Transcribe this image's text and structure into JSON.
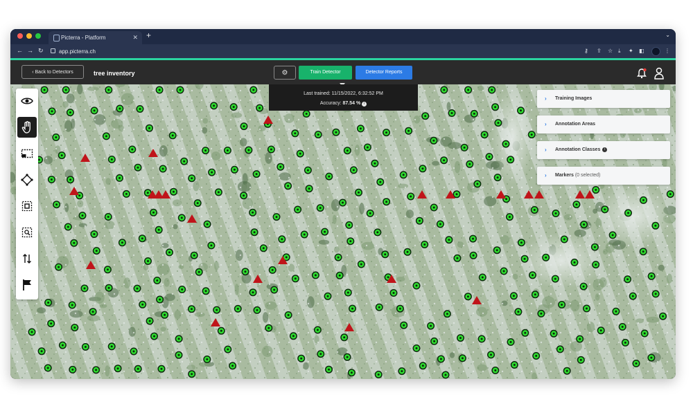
{
  "browser": {
    "tab_title": "Picterra - Platform",
    "url": "app.picterra.ch",
    "new_tab_icon": "plus-icon",
    "colors": {
      "frame": "#1f2a44",
      "accent_strip": "#2bd4a0"
    }
  },
  "header": {
    "back_label": "Back to Detectors",
    "project_title": "tree inventory",
    "train_label": "Train Detector",
    "reports_label": "Detector Reports",
    "colors": {
      "train": "#18b26b",
      "reports": "#2c7be5"
    }
  },
  "training_info": {
    "last_trained_label": "Last trained:",
    "last_trained_value": "11/15/2022, 6:32:52 PM",
    "accuracy_label": "Accuracy:",
    "accuracy_value": "87.54 %"
  },
  "tools": [
    "eye-icon",
    "hand-icon",
    "rectangle-select-icon",
    "polygon-icon",
    "box-icon",
    "zoom-box-icon",
    "sort-icon",
    "flag-icon"
  ],
  "panels": {
    "training_images": "Training Images",
    "annotation_areas": "Annotation Areas",
    "annotation_classes": "Annotation Classes",
    "markers": "Markers",
    "markers_sub": "(0 selected)"
  },
  "map": {
    "marker_colors": {
      "positive": "#2fdc2f",
      "negative": "#c0141a"
    }
  }
}
